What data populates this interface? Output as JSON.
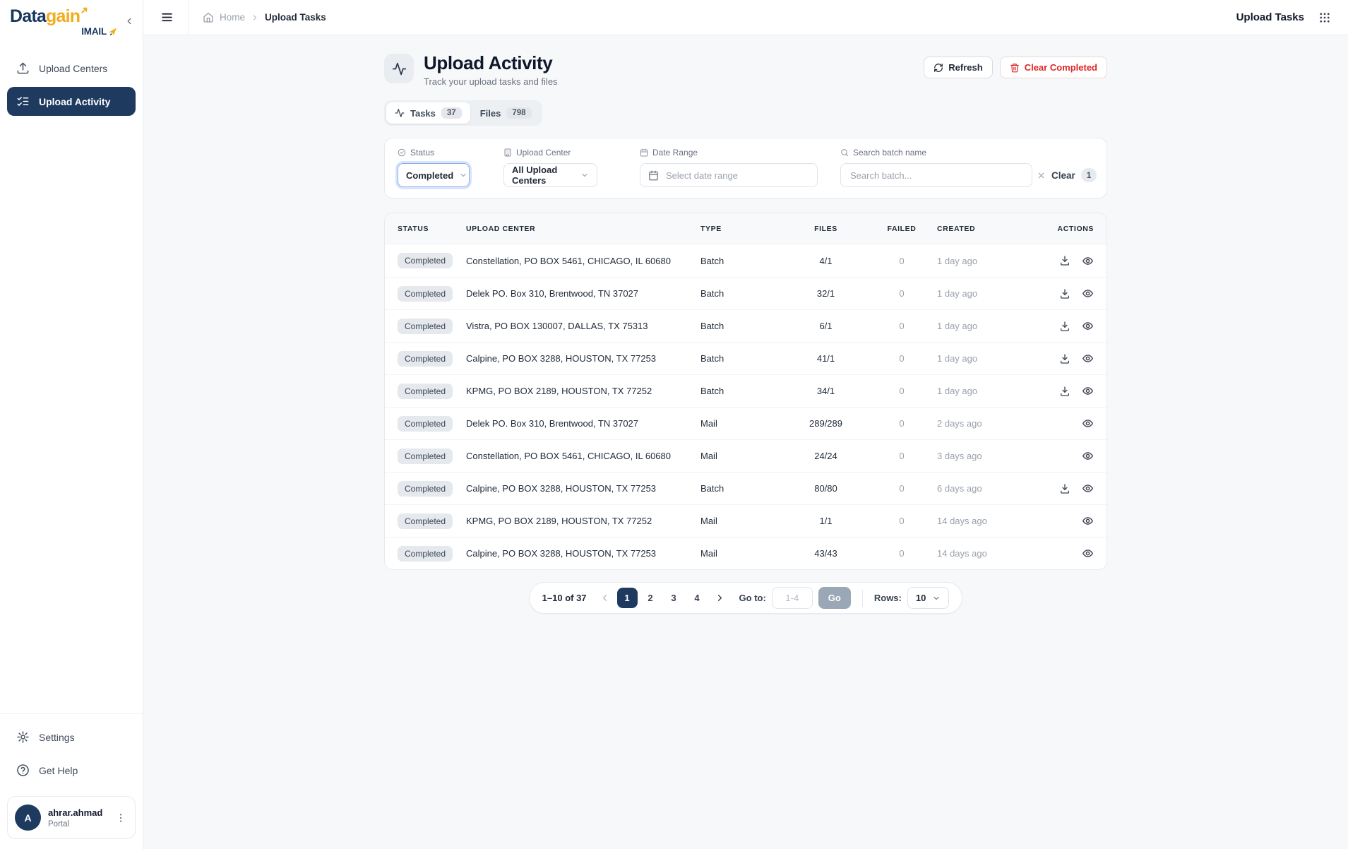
{
  "colors": {
    "navy": "#1e3a5f",
    "gold": "#f2ac1d",
    "danger": "#dc2626"
  },
  "brand": {
    "part1": "Data",
    "part2": "gain",
    "sub": "IMAIL"
  },
  "sidebar": {
    "items": [
      {
        "label": "Upload Centers"
      },
      {
        "label": "Upload Activity"
      }
    ],
    "footer_items": [
      {
        "label": "Settings"
      },
      {
        "label": "Get Help"
      }
    ],
    "user": {
      "initial": "A",
      "name": "ahrar.ahmad",
      "role": "Portal"
    }
  },
  "topbar": {
    "breadcrumb": {
      "home": "Home",
      "current": "Upload Tasks"
    },
    "right_title": "Upload Tasks"
  },
  "page": {
    "title": "Upload Activity",
    "subtitle": "Track your upload tasks and files",
    "refresh_label": "Refresh",
    "clear_completed_label": "Clear Completed"
  },
  "tabs": [
    {
      "label": "Tasks",
      "count": "37"
    },
    {
      "label": "Files",
      "count": "798"
    }
  ],
  "filters": {
    "status": {
      "label": "Status",
      "value": "Completed"
    },
    "upload_center": {
      "label": "Upload Center",
      "value": "All Upload Centers"
    },
    "date_range": {
      "label": "Date Range",
      "placeholder": "Select date range"
    },
    "search": {
      "label": "Search batch name",
      "placeholder": "Search batch..."
    },
    "clear": {
      "label": "Clear",
      "count": "1"
    }
  },
  "table": {
    "columns": [
      "STATUS",
      "UPLOAD CENTER",
      "TYPE",
      "FILES",
      "FAILED",
      "CREATED",
      "ACTIONS"
    ],
    "rows": [
      {
        "status": "Completed",
        "center": "Constellation, PO BOX 5461, CHICAGO, IL 60680",
        "type": "Batch",
        "files": "4/1",
        "failed": "0",
        "created": "1 day ago",
        "download": true
      },
      {
        "status": "Completed",
        "center": "Delek PO. Box 310, Brentwood, TN 37027",
        "type": "Batch",
        "files": "32/1",
        "failed": "0",
        "created": "1 day ago",
        "download": true
      },
      {
        "status": "Completed",
        "center": "Vistra, PO BOX 130007, DALLAS, TX 75313",
        "type": "Batch",
        "files": "6/1",
        "failed": "0",
        "created": "1 day ago",
        "download": true
      },
      {
        "status": "Completed",
        "center": "Calpine, PO BOX 3288, HOUSTON, TX 77253",
        "type": "Batch",
        "files": "41/1",
        "failed": "0",
        "created": "1 day ago",
        "download": true
      },
      {
        "status": "Completed",
        "center": "KPMG, PO BOX 2189, HOUSTON, TX 77252",
        "type": "Batch",
        "files": "34/1",
        "failed": "0",
        "created": "1 day ago",
        "download": true
      },
      {
        "status": "Completed",
        "center": "Delek PO. Box 310, Brentwood, TN 37027",
        "type": "Mail",
        "files": "289/289",
        "failed": "0",
        "created": "2 days ago",
        "download": false
      },
      {
        "status": "Completed",
        "center": "Constellation, PO BOX 5461, CHICAGO, IL 60680",
        "type": "Mail",
        "files": "24/24",
        "failed": "0",
        "created": "3 days ago",
        "download": false
      },
      {
        "status": "Completed",
        "center": "Calpine, PO BOX 3288, HOUSTON, TX 77253",
        "type": "Batch",
        "files": "80/80",
        "failed": "0",
        "created": "6 days ago",
        "download": true
      },
      {
        "status": "Completed",
        "center": "KPMG, PO BOX 2189, HOUSTON, TX 77252",
        "type": "Mail",
        "files": "1/1",
        "failed": "0",
        "created": "14 days ago",
        "download": false
      },
      {
        "status": "Completed",
        "center": "Calpine, PO BOX 3288, HOUSTON, TX 77253",
        "type": "Mail",
        "files": "43/43",
        "failed": "0",
        "created": "14 days ago",
        "download": false
      }
    ]
  },
  "pagination": {
    "range": "1–10 of 37",
    "pages": [
      "1",
      "2",
      "3",
      "4"
    ],
    "active_page": "1",
    "goto_label": "Go to:",
    "goto_placeholder": "1-4",
    "go_label": "Go",
    "rows_label": "Rows:",
    "rows_value": "10"
  }
}
